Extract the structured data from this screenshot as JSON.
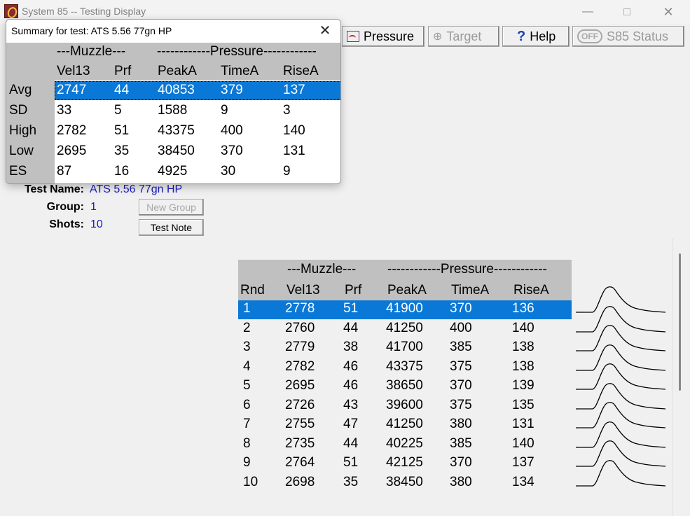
{
  "window": {
    "title": "System 85 -- Testing Display",
    "minimize": "—",
    "close": "✕"
  },
  "toolbar": {
    "pressure": "Pressure",
    "target": "Target",
    "help": "Help",
    "status": "S85 Status",
    "status_icon_text": "OFF",
    "help_icon_text": "?",
    "target_icon_text": "⊕"
  },
  "summary": {
    "title": "Summary for test:  ATS 5.56 77gn HP",
    "close": "✕",
    "group_muzzle": "---Muzzle---",
    "group_pressure": "------------Pressure------------",
    "columns": [
      "Vel13",
      "Prf",
      "PeakA",
      "TimeA",
      "RiseA"
    ],
    "rows": [
      {
        "label": "Avg",
        "values": [
          "2747",
          "44",
          "40853",
          "379",
          "137"
        ]
      },
      {
        "label": "SD",
        "values": [
          "33",
          "5",
          "1588",
          "9",
          "3"
        ]
      },
      {
        "label": "High",
        "values": [
          "2782",
          "51",
          "43375",
          "400",
          "140"
        ]
      },
      {
        "label": "Low",
        "values": [
          "2695",
          "35",
          "38450",
          "370",
          "131"
        ]
      },
      {
        "label": "ES",
        "values": [
          "87",
          "16",
          "4925",
          "30",
          "9"
        ]
      }
    ],
    "selected_row": 0
  },
  "info": {
    "test_name_label": "Test Name:",
    "test_name": "ATS 5.56 77gn HP",
    "group_label": "Group:",
    "group": "1",
    "shots_label": "Shots:",
    "shots": "10",
    "new_group": "New Group",
    "test_note": "Test Note"
  },
  "rounds": {
    "group_muzzle": "---Muzzle---",
    "group_pressure": "------------Pressure------------",
    "columns": [
      "Rnd",
      "Vel13",
      "Prf",
      "PeakA",
      "TimeA",
      "RiseA"
    ],
    "rows": [
      [
        "1",
        "2778",
        "51",
        "41900",
        "370",
        "136"
      ],
      [
        "2",
        "2760",
        "44",
        "41250",
        "400",
        "140"
      ],
      [
        "3",
        "2779",
        "38",
        "41700",
        "385",
        "138"
      ],
      [
        "4",
        "2782",
        "46",
        "43375",
        "375",
        "138"
      ],
      [
        "5",
        "2695",
        "46",
        "38650",
        "370",
        "139"
      ],
      [
        "6",
        "2726",
        "43",
        "39600",
        "375",
        "135"
      ],
      [
        "7",
        "2755",
        "47",
        "41250",
        "380",
        "131"
      ],
      [
        "8",
        "2735",
        "44",
        "40225",
        "385",
        "140"
      ],
      [
        "9",
        "2764",
        "51",
        "42125",
        "370",
        "137"
      ],
      [
        "10",
        "2698",
        "35",
        "38450",
        "380",
        "134"
      ]
    ],
    "selected_row": 0
  },
  "colors": {
    "selection": "#0a78d7",
    "header_bg": "#c0c0c0",
    "value_blue": "#1a1ac0"
  }
}
